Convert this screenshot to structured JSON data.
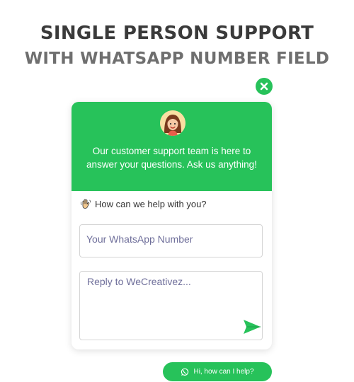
{
  "headline": {
    "line1": "SINGLE PERSON SUPPORT",
    "line2": "WITH WHATSAPP NUMBER FIELD"
  },
  "widget": {
    "header_text": "Our customer support team is here to answer your questions. Ask us anything!",
    "help_prompt": "How can we help with you?",
    "phone_placeholder": "Your WhatsApp Number",
    "phone_value": "",
    "reply_placeholder": "Reply to WeCreativez...",
    "reply_value": ""
  },
  "launcher": {
    "label": "Hi, how can I help?"
  },
  "icons": {
    "close": "close-icon",
    "avatar": "support-agent-avatar",
    "wave": "waving-hand-icon",
    "send": "send-icon",
    "whatsapp": "whatsapp-icon"
  },
  "colors": {
    "accent": "#27c25a",
    "headline_primary": "#3a3a3a",
    "headline_secondary": "#6f6f6f"
  }
}
